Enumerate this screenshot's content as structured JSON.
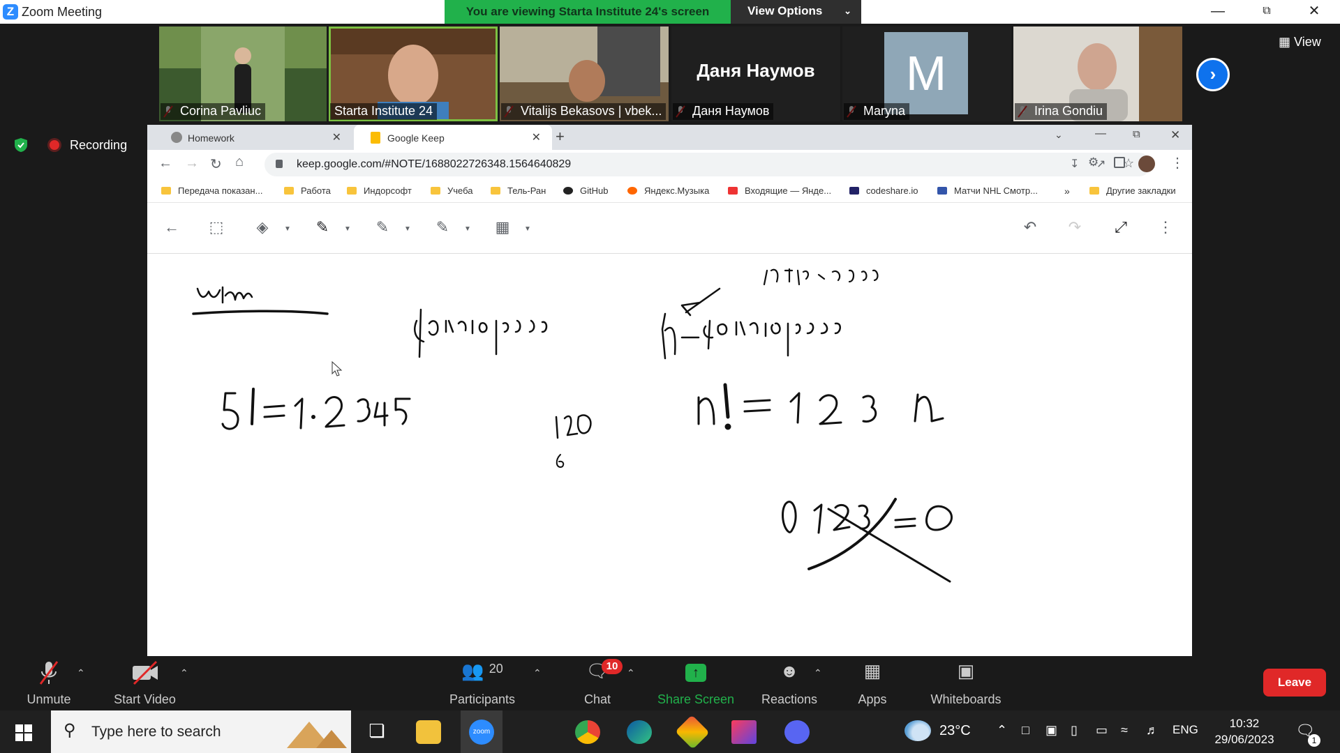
{
  "zoom": {
    "window_title": "Zoom Meeting",
    "share_banner": "You are viewing Starta Institute 24's screen",
    "view_options": "View Options",
    "view_label": "View",
    "recording": "Recording",
    "participants": [
      {
        "name": "Corina Pavliuc"
      },
      {
        "name": "Starta Institute 24"
      },
      {
        "name": "Vitalijs Bekasovs | vbek..."
      },
      {
        "name": "Даня Наумов",
        "big_label": "Даня Наумов"
      },
      {
        "name": "Maryna",
        "initial": "M"
      },
      {
        "name": "Irina Gondiu"
      }
    ],
    "toolbar": {
      "unmute": "Unmute",
      "start_video": "Start Video",
      "participants": "Participants",
      "participants_count": "20",
      "chat": "Chat",
      "chat_badge": "10",
      "share_screen": "Share Screen",
      "reactions": "Reactions",
      "apps": "Apps",
      "whiteboards": "Whiteboards",
      "leave": "Leave"
    },
    "colors": {
      "accent": "#2d8cff",
      "share_green": "#21b14b",
      "leave_red": "#e02828"
    }
  },
  "chrome": {
    "tabs": [
      {
        "label": "Homework"
      },
      {
        "label": "Google Keep"
      }
    ],
    "url": "keep.google.com/#NOTE/1688022726348.1564640829",
    "bookmarks": [
      "Передача показан...",
      "Работа",
      "Индорсофт",
      "Учеба",
      "Тель-Ран",
      "GitHub",
      "Яндекс.Музыка",
      "Входящие — Янде...",
      "codeshare.io",
      "Матчи NHL Смотр..."
    ],
    "more": "»",
    "other_bookmarks": "Другие закладки"
  },
  "taskbar": {
    "search_placeholder": "Type here to search",
    "weather": "23°C",
    "lang": "ENG",
    "time": "10:32",
    "date": "29/06/2023",
    "notifications": "1"
  }
}
